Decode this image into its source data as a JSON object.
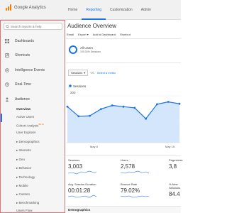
{
  "app": {
    "name": "Google Analytics"
  },
  "topnav": [
    {
      "label": "Home",
      "active": false
    },
    {
      "label": "Reporting",
      "active": true
    },
    {
      "label": "Customization",
      "active": false
    },
    {
      "label": "Admin",
      "active": false
    }
  ],
  "sidebar": {
    "search_placeholder": "Search reports & help",
    "items": [
      {
        "label": "Dashboards",
        "icon": "dashboard-icon"
      },
      {
        "label": "Shortcuts",
        "icon": "shortcut-icon"
      },
      {
        "label": "Intelligence Events",
        "icon": "intelligence-icon"
      },
      {
        "label": "Real-Time",
        "icon": "realtime-icon"
      },
      {
        "label": "Audience",
        "icon": "audience-icon"
      }
    ],
    "subitems": [
      {
        "label": "Overview",
        "active": true
      },
      {
        "label": "Active Users"
      },
      {
        "label": "Cohort Analysis",
        "badge": "BETA"
      },
      {
        "label": "User Explorer"
      },
      {
        "label": "▸ Demographics"
      },
      {
        "label": "▸ Interests"
      },
      {
        "label": "▸ Geo"
      },
      {
        "label": "▸ Behavior"
      },
      {
        "label": "▸ Technology"
      },
      {
        "label": "▸ Mobile"
      },
      {
        "label": "▸ Custom"
      },
      {
        "label": "▸ Benchmarking"
      },
      {
        "label": "Users Flow"
      }
    ]
  },
  "main": {
    "title": "Audience Overview",
    "actions": [
      "Email",
      "Export ▾",
      "Add to Dashboard",
      "Shortcut"
    ],
    "segment": {
      "name": "All Users",
      "detail": "100.00% Sessions"
    },
    "metric_select": "Sessions",
    "vs_label": "VS.",
    "select_metric_link": "Select a metric",
    "legend_label": "Sessions",
    "ytick_top": "200",
    "ytick_mid": "100",
    "xticks": [
      "May 8",
      "May 15"
    ],
    "demographics_label": "Demographics"
  },
  "chart_data": {
    "type": "area",
    "series": [
      {
        "name": "Sessions",
        "values": [
          150,
          110,
          112,
          140,
          155,
          150,
          145,
          100,
          160,
          170,
          162
        ]
      }
    ],
    "ylim": [
      0,
      260
    ],
    "yticks": [
      100,
      200
    ],
    "xticks": [
      "May 8",
      "May 15"
    ],
    "color": "#1a73e8"
  },
  "metrics": [
    {
      "label": "Sessions",
      "value": "3,003"
    },
    {
      "label": "Users",
      "value": "2,578"
    },
    {
      "label": "Pageviews",
      "value": "3,8"
    },
    {
      "label": "Avg. Session Duration",
      "value": "00:01:28"
    },
    {
      "label": "Bounce Rate",
      "value": "79.02%"
    },
    {
      "label": "% New Sessions",
      "value": "84.4"
    }
  ],
  "colors": {
    "accent": "#1a73e8",
    "logo": "#f57c00",
    "sidebar_border": "#e57373"
  }
}
